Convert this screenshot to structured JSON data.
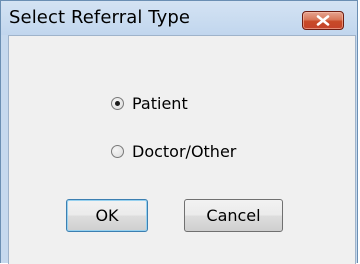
{
  "window": {
    "title": "Select Referral Type"
  },
  "titlebar": {
    "close_icon": "close-icon",
    "close_color": "#c84a28"
  },
  "options": [
    {
      "label": "Patient",
      "selected": true
    },
    {
      "label": "Doctor/Other",
      "selected": false
    }
  ],
  "buttons": {
    "ok_label": "OK",
    "cancel_label": "Cancel"
  }
}
